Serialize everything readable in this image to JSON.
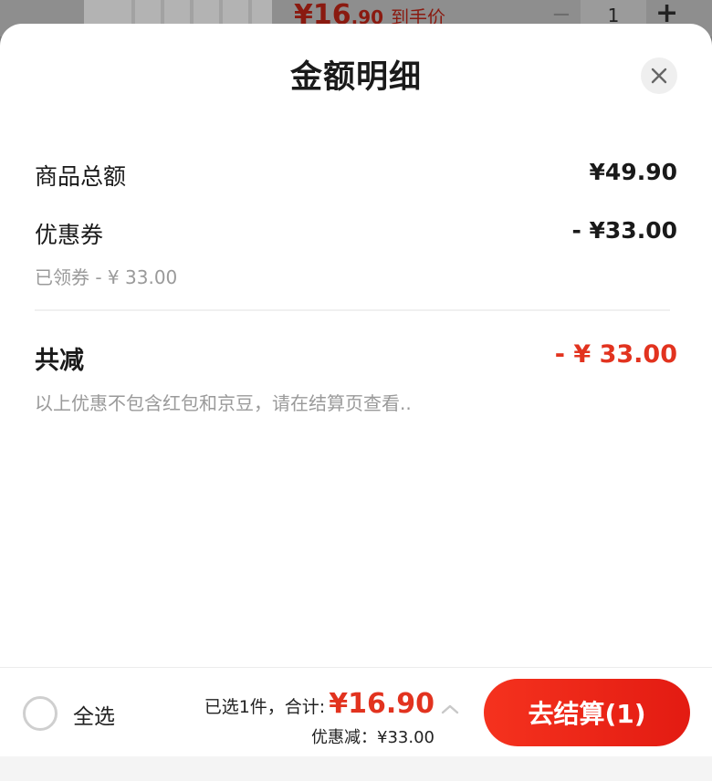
{
  "background": {
    "price_main": "¥16",
    "price_fraction": ".90",
    "price_label": "到手价",
    "minus_label": "−",
    "quantity": "1",
    "plus_label": "+"
  },
  "sheet": {
    "title": "金额明细",
    "close_icon": "close-icon",
    "items": [
      {
        "label": "商品总额",
        "value": "¥49.90"
      },
      {
        "label": "优惠券",
        "value": "- ¥33.00",
        "note": "已领券 - ¥ 33.00"
      }
    ],
    "total": {
      "label": "共减",
      "value": "- ¥ 33.00",
      "note": "以上优惠不包含红包和京豆，请在结算页查看.."
    }
  },
  "bar": {
    "select_all": "全选",
    "summary_prefix": "已选1件，合计:",
    "summary_price": "¥16.90",
    "discount": "优惠减：¥33.00",
    "checkout": "去结算(1)"
  },
  "colors": {
    "accent": "#e2331f",
    "text": "#1a1a1a",
    "muted": "#9a9a9a"
  }
}
